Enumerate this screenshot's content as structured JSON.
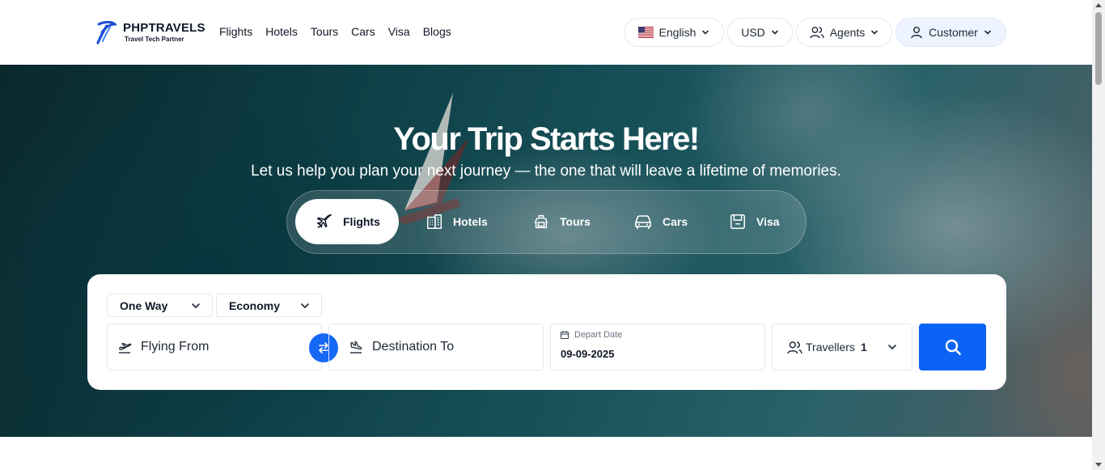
{
  "brand": {
    "name": "PHPTRAVELS",
    "tagline": "Travel Tech Partner"
  },
  "nav": {
    "items": [
      "Flights",
      "Hotels",
      "Tours",
      "Cars",
      "Visa",
      "Blogs"
    ]
  },
  "header_buttons": {
    "language": "English",
    "currency": "USD",
    "agents": "Agents",
    "customer": "Customer"
  },
  "hero": {
    "title": "Your Trip Starts Here!",
    "subtitle": "Let us help you plan your next journey — the one that will leave a lifetime of memories."
  },
  "tabs": [
    {
      "label": "Flights",
      "icon": "plane-icon",
      "active": true
    },
    {
      "label": "Hotels",
      "icon": "building-icon",
      "active": false
    },
    {
      "label": "Tours",
      "icon": "backpack-icon",
      "active": false
    },
    {
      "label": "Cars",
      "icon": "car-icon",
      "active": false
    },
    {
      "label": "Visa",
      "icon": "passport-icon",
      "active": false
    }
  ],
  "search": {
    "trip_type": "One Way",
    "cabin_class": "Economy",
    "from_placeholder": "Flying From",
    "to_placeholder": "Destination To",
    "depart_label": "Depart Date",
    "depart_value": "09-09-2025",
    "travellers_label": "Travellers",
    "travellers_count": "1"
  },
  "colors": {
    "primary": "#0b63f6",
    "swap": "#1668f5",
    "customer_bg": "#eef4ff"
  }
}
